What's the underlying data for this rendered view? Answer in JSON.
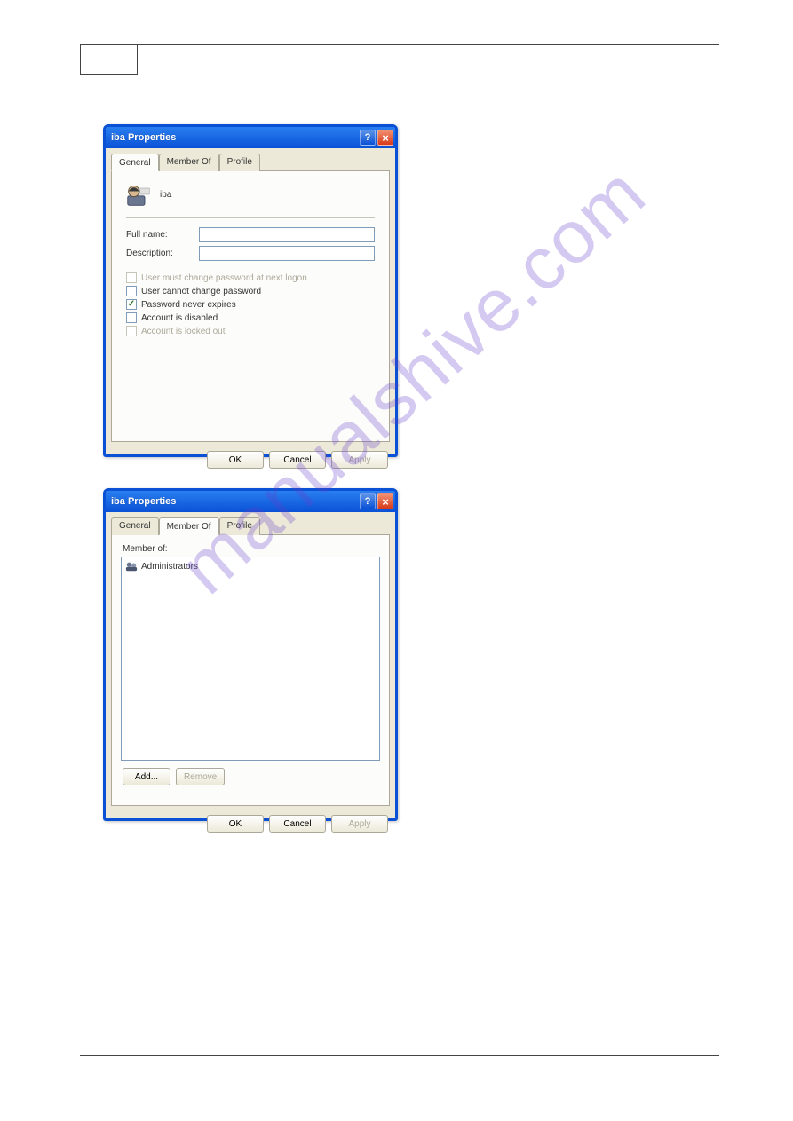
{
  "watermark": "manualshive.com",
  "dialog1": {
    "title": "iba Properties",
    "help_symbol": "?",
    "close_symbol": "×",
    "tabs": [
      "General",
      "Member Of",
      "Profile"
    ],
    "active_tab": 0,
    "user_name": "iba",
    "full_name_label": "Full name:",
    "full_name_value": "",
    "description_label": "Description:",
    "description_value": "",
    "checks": [
      {
        "label": "User must change password at next logon",
        "checked": false,
        "disabled": true
      },
      {
        "label": "User cannot change password",
        "checked": false,
        "disabled": false
      },
      {
        "label": "Password never expires",
        "checked": true,
        "disabled": false
      },
      {
        "label": "Account is disabled",
        "checked": false,
        "disabled": false
      },
      {
        "label": "Account is locked out",
        "checked": false,
        "disabled": true
      }
    ],
    "ok": "OK",
    "cancel": "Cancel",
    "apply": "Apply"
  },
  "dialog2": {
    "title": "iba Properties",
    "help_symbol": "?",
    "close_symbol": "×",
    "tabs": [
      "General",
      "Member Of",
      "Profile"
    ],
    "active_tab": 1,
    "member_of_label": "Member of:",
    "members": [
      "Administrators"
    ],
    "add": "Add...",
    "remove": "Remove",
    "ok": "OK",
    "cancel": "Cancel",
    "apply": "Apply"
  }
}
